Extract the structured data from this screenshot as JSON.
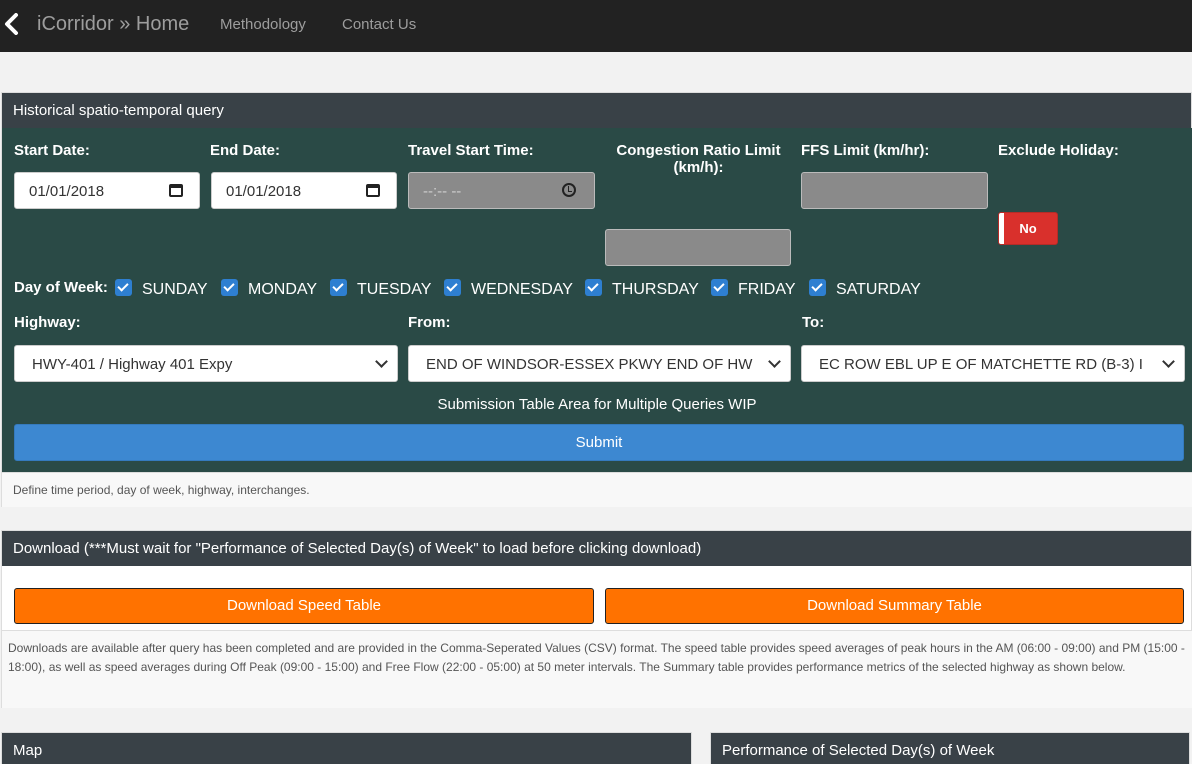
{
  "nav": {
    "brand": "iCorridor » Home",
    "links": [
      "Methodology",
      "Contact Us"
    ]
  },
  "query": {
    "heading": "Historical spatio-temporal query",
    "start_date_label": "Start Date:",
    "start_date_value": "01/01/2018",
    "end_date_label": "End Date:",
    "end_date_value": "01/01/2018",
    "travel_start_label": "Travel Start Time:",
    "travel_start_placeholder": "--:-- --",
    "congestion_label_line1": "Congestion Ratio Limit",
    "congestion_label_line2": "(km/h):",
    "ffs_label": "FFS Limit (km/hr):",
    "exclude_holiday_label": "Exclude Holiday:",
    "exclude_holiday_value": "No",
    "day_of_week_label": "Day of Week:",
    "days": [
      "SUNDAY",
      "MONDAY",
      "TUESDAY",
      "WEDNESDAY",
      "THURSDAY",
      "FRIDAY",
      "SATURDAY"
    ],
    "highway_label": "Highway:",
    "highway_value": "HWY-401 / Highway 401 Expy",
    "from_label": "From:",
    "from_value": "END OF WINDSOR-ESSEX PKWY END OF HW",
    "to_label": "To:",
    "to_value": "EC ROW EBL UP E OF MATCHETTE RD (B-3) I",
    "wip_text": "Submission Table Area for Multiple Queries WIP",
    "submit_label": "Submit",
    "footer": "Define time period, day of week, highway, interchanges."
  },
  "download": {
    "heading": "Download (***Must wait for \"Performance of Selected Day(s) of Week\" to load before clicking download)",
    "speed_button": "Download Speed Table",
    "summary_button": "Download Summary Table",
    "footer": "Downloads are available after query has been completed and are provided in the Comma-Seperated Values (CSV) format. The speed table provides speed averages of peak hours in the AM (06:00 - 09:00) and PM (15:00 - 18:00), as well as speed averages during Off Peak (09:00 - 15:00) and Free Flow (22:00 - 05:00) at 50 meter intervals. The Summary table provides performance metrics of the selected highway as shown below."
  },
  "map": {
    "heading": "Map"
  },
  "performance": {
    "heading": "Performance of Selected Day(s) of Week"
  },
  "colors": {
    "navbar": "#222222",
    "panel_heading": "#394147",
    "query_body": "#2a4a46",
    "submit": "#3d88d1",
    "download": "#ff7200",
    "toggle_no": "#d9302c",
    "checkbox": "#2e7fd1"
  }
}
